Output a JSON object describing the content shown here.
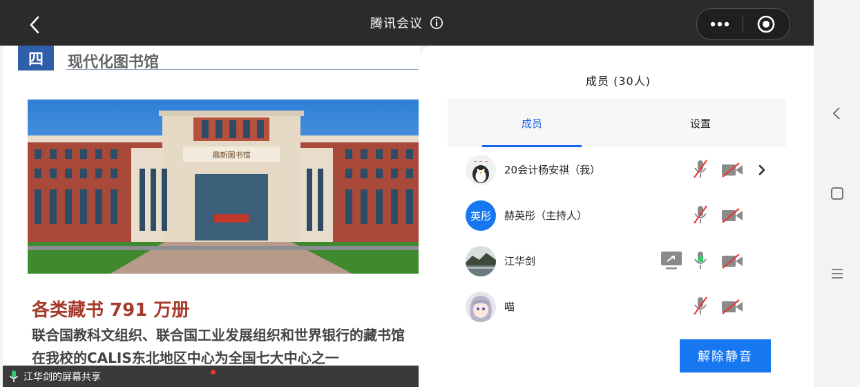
{
  "header": {
    "title": "腾讯会议"
  },
  "slide": {
    "number": "四",
    "title": "现代化图书馆",
    "building_sign": "鼎新图书馆",
    "headline": "各类藏书 791 万册",
    "lines": [
      "联合国教科文组织、联合国工业发展组织和世界银行的藏书馆",
      "在我校的CALIS东北地区中心为全国七大中心之一"
    ]
  },
  "share_status": "江华剑的屏幕共享",
  "panel": {
    "title": "成员 (30人)",
    "tabs": [
      {
        "label": "成员"
      },
      {
        "label": "设置"
      }
    ]
  },
  "members": [
    {
      "name": "20会计杨安祺（我）",
      "avatar": "penguin"
    },
    {
      "name": "赫英彤（主持人）",
      "avatar_text": "英彤"
    },
    {
      "name": "江华剑",
      "avatar": "landscape",
      "sharing": true
    },
    {
      "name": "喵",
      "avatar": "anime"
    }
  ],
  "unmute_button": "解除静音",
  "colors": {
    "accent": "#1677f0",
    "topbar": "#2b2b2b",
    "muted_red": "#e53935",
    "speaking_green": "#37c871",
    "slide_blue": "#2e5fa8",
    "headline_red": "#a63a2a"
  }
}
